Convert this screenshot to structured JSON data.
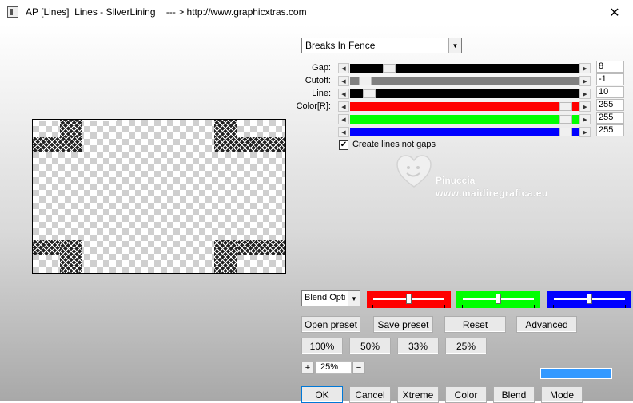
{
  "window": {
    "title": "AP [Lines]  Lines - SilverLining    --- > http://www.graphicxtras.com",
    "close_label": "✕"
  },
  "effect_dropdown": {
    "selected": "Breaks In Fence"
  },
  "sliders": [
    {
      "label": "Gap:",
      "value": "8",
      "fraction": 0.15,
      "color": "#000000"
    },
    {
      "label": "Cutoff:",
      "value": "-1",
      "fraction": 0.04,
      "color": "#808080"
    },
    {
      "label": "Line:",
      "value": "10",
      "fraction": 0.06,
      "color": "#000000"
    },
    {
      "label": "Color[R]:",
      "value": "255",
      "fraction": 0.97,
      "color": "#ff0000"
    },
    {
      "label": "",
      "value": "255",
      "fraction": 0.97,
      "color": "#00ff00"
    },
    {
      "label": "",
      "value": "255",
      "fraction": 0.97,
      "color": "#0000ff"
    }
  ],
  "checkbox": {
    "label": "Create lines not gaps",
    "checked": true,
    "mark": "✔"
  },
  "watermark": {
    "line1": "Pinuccia",
    "line2": "www.maidiregrafica.eu"
  },
  "blend_options": {
    "selected": "Blend Opti"
  },
  "color_swatches": [
    {
      "color": "#ff0000",
      "level": 0.5
    },
    {
      "color": "#00ff00",
      "level": 0.5
    },
    {
      "color": "#0000ff",
      "level": 0.5
    }
  ],
  "buttons": {
    "open_preset": "Open preset",
    "save_preset": "Save preset",
    "reset": "Reset",
    "advanced": "Advanced",
    "z100": "100%",
    "z50": "50%",
    "z33": "33%",
    "z25": "25%",
    "ok": "OK",
    "cancel": "Cancel",
    "xtreme": "Xtreme",
    "color": "Color",
    "blend": "Blend",
    "mode": "Mode"
  },
  "zoom": {
    "plus": "+",
    "value": "25%",
    "minus": "−"
  },
  "accent_color": "#3399ff"
}
